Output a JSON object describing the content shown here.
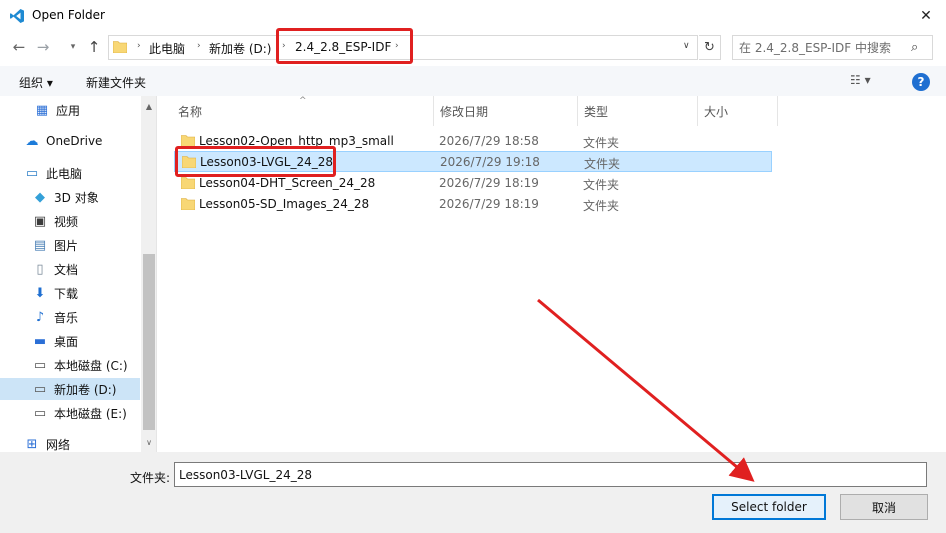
{
  "window": {
    "title": "Open Folder",
    "close_symbol": "✕"
  },
  "nav": {
    "back_symbol": "←",
    "forward_symbol": "→",
    "recent_symbol": "▾",
    "up_symbol": "↑",
    "refresh_symbol": "↻"
  },
  "address": {
    "crumbs": [
      "此电脑",
      "新加卷 (D:)",
      "2.4_2.8_ESP-IDF"
    ],
    "separator": "›",
    "dropdown_symbol": "∨"
  },
  "search": {
    "placeholder": "在 2.4_2.8_ESP-IDF 中搜索",
    "icon": "⌕"
  },
  "toolbar": {
    "organize_label": "组织 ▾",
    "new_folder_label": "新建文件夹",
    "view_label": "☷ ▾",
    "help_label": "?"
  },
  "sidebar": {
    "items": [
      {
        "label": "应用",
        "icon": "apps-icon",
        "glyph": "▦",
        "color": "#2b6fd6"
      },
      {
        "label": "OneDrive",
        "icon": "cloud-icon",
        "glyph": "☁",
        "color": "#1c7bd9"
      },
      {
        "label": "此电脑",
        "icon": "computer-icon",
        "glyph": "▭",
        "color": "#2e80c8"
      },
      {
        "label": "3D 对象",
        "icon": "cube-icon",
        "glyph": "◆",
        "color": "#34a0d8"
      },
      {
        "label": "视频",
        "icon": "video-icon",
        "glyph": "▣",
        "color": "#3c3c3c"
      },
      {
        "label": "图片",
        "icon": "picture-icon",
        "glyph": "▤",
        "color": "#4a7fb5"
      },
      {
        "label": "文档",
        "icon": "document-icon",
        "glyph": "▯",
        "color": "#7a8a99"
      },
      {
        "label": "下载",
        "icon": "download-icon",
        "glyph": "⬇",
        "color": "#1f6fd1"
      },
      {
        "label": "音乐",
        "icon": "music-icon",
        "glyph": "♪",
        "color": "#1f6fd1"
      },
      {
        "label": "桌面",
        "icon": "desktop-icon",
        "glyph": "▬",
        "color": "#2b6fd6"
      },
      {
        "label": "本地磁盘 (C:)",
        "icon": "drive-c-icon",
        "glyph": "▭",
        "color": "#555555"
      },
      {
        "label": "新加卷 (D:)",
        "icon": "drive-d-icon",
        "glyph": "▭",
        "color": "#555555",
        "selected": true
      },
      {
        "label": "本地磁盘 (E:)",
        "icon": "drive-e-icon",
        "glyph": "▭",
        "color": "#555555"
      },
      {
        "label": "网络",
        "icon": "network-icon",
        "glyph": "⊞",
        "color": "#2b6fd6"
      }
    ],
    "scroll_up": "▲",
    "scroll_down": "∨"
  },
  "columns": {
    "name": "名称",
    "date": "修改日期",
    "type": "类型",
    "size": "大小",
    "sort_symbol": "^"
  },
  "files": [
    {
      "name": "Lesson02-Open_http_mp3_small",
      "date": "2026/7/29 18:58",
      "type": "文件夹"
    },
    {
      "name": "Lesson03-LVGL_24_28",
      "date": "2026/7/29 19:18",
      "type": "文件夹",
      "selected": true
    },
    {
      "name": "Lesson04-DHT_Screen_24_28",
      "date": "2026/7/29 18:19",
      "type": "文件夹"
    },
    {
      "name": "Lesson05-SD_Images_24_28",
      "date": "2026/7/29 18:19",
      "type": "文件夹"
    }
  ],
  "bottom": {
    "folder_label": "文件夹:",
    "folder_value": "Lesson03-LVGL_24_28",
    "select_label": "Select folder",
    "cancel_label": "取消"
  },
  "colors": {
    "annotation_red": "#e02020",
    "selection_blue": "#cce8ff",
    "accent_blue": "#0078d7",
    "folder_yellow": "#f8d775"
  }
}
